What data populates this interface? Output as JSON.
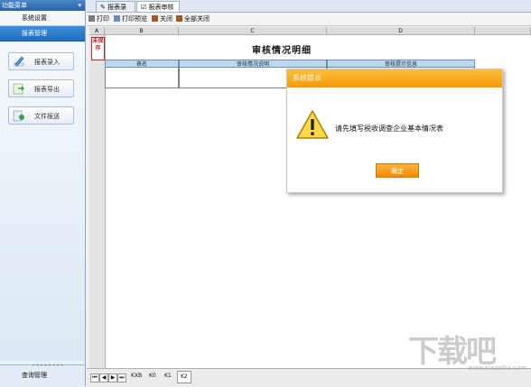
{
  "sidebar": {
    "title": "功能菜单",
    "pin": "▾",
    "sections": [
      {
        "label": "系统设置"
      },
      {
        "label": "报表管理"
      }
    ],
    "items": [
      {
        "label": "报表录入",
        "icon": "pencil-icon"
      },
      {
        "label": "报表导出",
        "icon": "export-icon"
      },
      {
        "label": "文件报送",
        "icon": "send-file-icon"
      }
    ],
    "bottom": {
      "dots": "••••••••",
      "label": "查询管理"
    }
  },
  "tabs": [
    {
      "label": "报表录入",
      "icon": "edit-icon"
    },
    {
      "label": "报表审核",
      "icon": "audit-icon"
    }
  ],
  "toolbar": {
    "print": "打印",
    "print_preview": "打印预览",
    "close": "关闭",
    "close_all": "全部关闭"
  },
  "sheet": {
    "columns": [
      "A",
      "B",
      "C",
      "D"
    ],
    "stamp": "未保存",
    "title": "审核情况明细",
    "headers": [
      "表名",
      "审核情况说明",
      "审核提示信息"
    ],
    "tabs": [
      "KXB",
      "K0",
      "K1",
      "K2"
    ]
  },
  "dialog": {
    "title": "系统提示",
    "message": "请先填写税收调查企业基本情况表",
    "ok": "确定"
  },
  "watermark": {
    "text": "下载吧",
    "url": "www.xiazaiba.com"
  },
  "colors": {
    "accent": "#f39a06",
    "header_blue": "#bdd7ee",
    "stamp_red": "#c0272d"
  }
}
